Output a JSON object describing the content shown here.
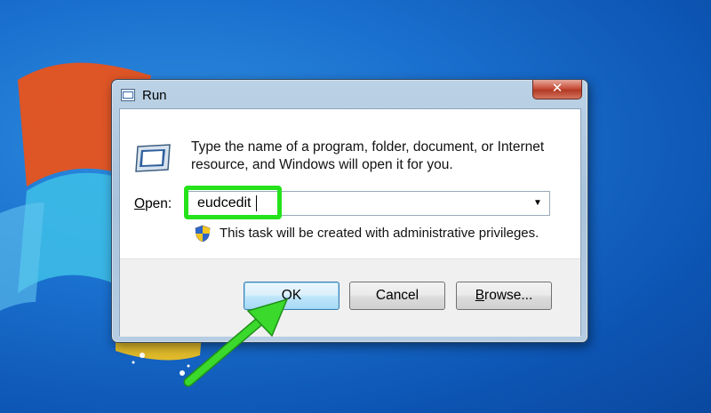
{
  "dialog": {
    "title": "Run",
    "close_label": "✕",
    "description": "Type the name of a program, folder, document, or Internet resource, and Windows will open it for you.",
    "open_label_prefix": "",
    "open_label_access": "O",
    "open_label_rest": "pen:",
    "open_value": "eudcedit",
    "dropdown_glyph": "▼",
    "admin_notice": "This task will be created with administrative privileges.",
    "buttons": {
      "ok": "OK",
      "cancel": "Cancel",
      "browse_access": "B",
      "browse_rest": "rowse..."
    }
  },
  "colors": {
    "highlight": "#25e21b",
    "arrow": "#3ad92c"
  },
  "icons": [
    "run-program-icon",
    "run-large-icon",
    "close-icon",
    "shield-icon",
    "chevron-down-icon",
    "pointer-arrow"
  ]
}
